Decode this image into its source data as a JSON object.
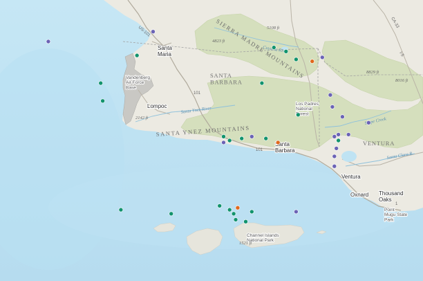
{
  "places": {
    "santa_maria": "Santa\nMaria",
    "vandenberg": "Vandenberg\nAir Force\nBase",
    "lompoc": "Lompoc",
    "santa_barbara_city": "Santa\nBarbara",
    "los_padres": "Los Padres\nNational\nForest",
    "ventura_city": "Ventura",
    "oxnard": "Oxnard",
    "thousand_oaks": "Thousand\nOaks",
    "point_mugu": "Point\nMugu State\nPark",
    "channel_islands": "Channel Islands\nNational Park"
  },
  "regions": {
    "santa_barbara_county": "SANTA\nBARBARA",
    "ventura_county": "VENTURA",
    "sierra_madre": "SIERRA MADRE MOUNTAINS",
    "santa_ynez_mtns": "SANTA YNEZ MOUNTAINS"
  },
  "rivers": {
    "santa_ynez": "Santa Ynez River",
    "cuyama": "Cuyama River",
    "sespe": "Sespe Creek",
    "santa_clara": "Santa Clara R"
  },
  "elevations": [
    "5108 ft",
    "4823 ft",
    "8829 ft",
    "8016 ft",
    "2142 ft",
    "1521 ft"
  ],
  "roads": [
    "US-101",
    "101",
    "CA-33",
    "I-5",
    "101",
    "1"
  ],
  "markers": {
    "colors": {
      "green": "#12936d",
      "purple": "#6b63b5",
      "orange": "#e0681c"
    },
    "points": [
      {
        "c": "purple",
        "lon": -120.66,
        "lat": 35.05
      },
      {
        "c": "purple",
        "lon": -120.14,
        "lat": 35.1
      },
      {
        "c": "green",
        "lon": -120.22,
        "lat": 34.98
      },
      {
        "c": "green",
        "lon": -119.54,
        "lat": 35.02
      },
      {
        "c": "green",
        "lon": -119.48,
        "lat": 35.0
      },
      {
        "c": "green",
        "lon": -119.43,
        "lat": 34.96
      },
      {
        "c": "orange",
        "lon": -119.35,
        "lat": 34.95
      },
      {
        "c": "purple",
        "lon": -119.3,
        "lat": 34.97
      },
      {
        "c": "green",
        "lon": -120.4,
        "lat": 34.84
      },
      {
        "c": "green",
        "lon": -120.39,
        "lat": 34.75
      },
      {
        "c": "green",
        "lon": -119.6,
        "lat": 34.84
      },
      {
        "c": "purple",
        "lon": -119.26,
        "lat": 34.78
      },
      {
        "c": "purple",
        "lon": -119.25,
        "lat": 34.72
      },
      {
        "c": "green",
        "lon": -119.42,
        "lat": 34.68
      },
      {
        "c": "purple",
        "lon": -119.2,
        "lat": 34.67
      },
      {
        "c": "purple",
        "lon": -119.07,
        "lat": 34.64
      },
      {
        "c": "green",
        "lon": -119.79,
        "lat": 34.57
      },
      {
        "c": "green",
        "lon": -119.76,
        "lat": 34.55
      },
      {
        "c": "green",
        "lon": -119.7,
        "lat": 34.56
      },
      {
        "c": "purple",
        "lon": -119.65,
        "lat": 34.57
      },
      {
        "c": "purple",
        "lon": -119.79,
        "lat": 34.54
      },
      {
        "c": "green",
        "lon": -119.58,
        "lat": 34.56
      },
      {
        "c": "orange",
        "lon": -119.52,
        "lat": 34.54
      },
      {
        "c": "purple",
        "lon": -119.24,
        "lat": 34.57
      },
      {
        "c": "purple",
        "lon": -119.22,
        "lat": 34.58
      },
      {
        "c": "purple",
        "lon": -119.17,
        "lat": 34.58
      },
      {
        "c": "green",
        "lon": -119.22,
        "lat": 34.55
      },
      {
        "c": "purple",
        "lon": -119.23,
        "lat": 34.51
      },
      {
        "c": "purple",
        "lon": -119.24,
        "lat": 34.47
      },
      {
        "c": "purple",
        "lon": -119.24,
        "lat": 34.42
      },
      {
        "c": "green",
        "lon": -120.3,
        "lat": 34.2
      },
      {
        "c": "green",
        "lon": -120.05,
        "lat": 34.18
      },
      {
        "c": "green",
        "lon": -119.81,
        "lat": 34.22
      },
      {
        "c": "green",
        "lon": -119.76,
        "lat": 34.2
      },
      {
        "c": "green",
        "lon": -119.74,
        "lat": 34.18
      },
      {
        "c": "orange",
        "lon": -119.72,
        "lat": 34.21
      },
      {
        "c": "green",
        "lon": -119.65,
        "lat": 34.19
      },
      {
        "c": "green",
        "lon": -119.73,
        "lat": 34.15
      },
      {
        "c": "green",
        "lon": -119.68,
        "lat": 34.14
      },
      {
        "c": "purple",
        "lon": -119.43,
        "lat": 34.19
      }
    ]
  }
}
